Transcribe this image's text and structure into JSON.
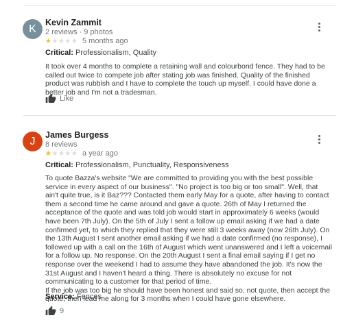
{
  "reviews": [
    {
      "avatar_letter": "K",
      "avatar_color": "#78909c",
      "name": "Kevin Zammit",
      "meta": "2 reviews · 9 photos",
      "rating": 1,
      "max_rating": 5,
      "date": "5 months ago",
      "critical_label": "Critical:",
      "critical_value": "Professionalism, Quality",
      "text": [
        "It took over 4 months to complete a retaining wall and colourbond fence. They had to be called out twice to compete job after stating job was finished. Quality of the finished product was rubbish and I have to complete the touch up myself. I could have done a better job and I'm not a tradesman."
      ],
      "like_label": "Like"
    },
    {
      "avatar_letter": "J",
      "avatar_color": "#d84315",
      "name": "James Burgess",
      "meta": "8 reviews",
      "rating": 1,
      "max_rating": 5,
      "date": "a year ago",
      "critical_label": "Critical:",
      "critical_value": "Professionalism, Punctuality, Responsiveness",
      "text": [
        "To quote Bazza's website \"We are committed to providing you with the best possible service in every aspect of our business\". \"No project is too big or too small\". Well, that ain't quite true, is it Baz??? Contacted them early May for a quote, after having to contact them a second time he came around and gave a quote. 26th of May I returned the acceptance of the quote and was told job would start in approximately 6 weeks (would have been 7th July). On the 5th of July I sent a follow up email asking if we had a date confirmed yet, to which they replied that they were still 3 weeks away (now 26th July). On the 13th August I sent another email asking if we had a date confirmed (no response), I followed up with a call on the 16th of August which went unanswered and I left a voicemail for a follow up. No response. On the 20th August I sent a final email saying if I get no response over the weekend I had to assume they have abandoned the job. It's now the 31st August and I haven't heard a thing. There is absolutely no excuse for not communicating to a customer for that period of time.",
        "If the job was too big he should have been honest and said so, not quote, then accept the quote, then lead me along for 3 months when I could have gone elsewhere."
      ],
      "service_label": "Service:",
      "service_value": "Fences",
      "like_count": "9"
    }
  ]
}
